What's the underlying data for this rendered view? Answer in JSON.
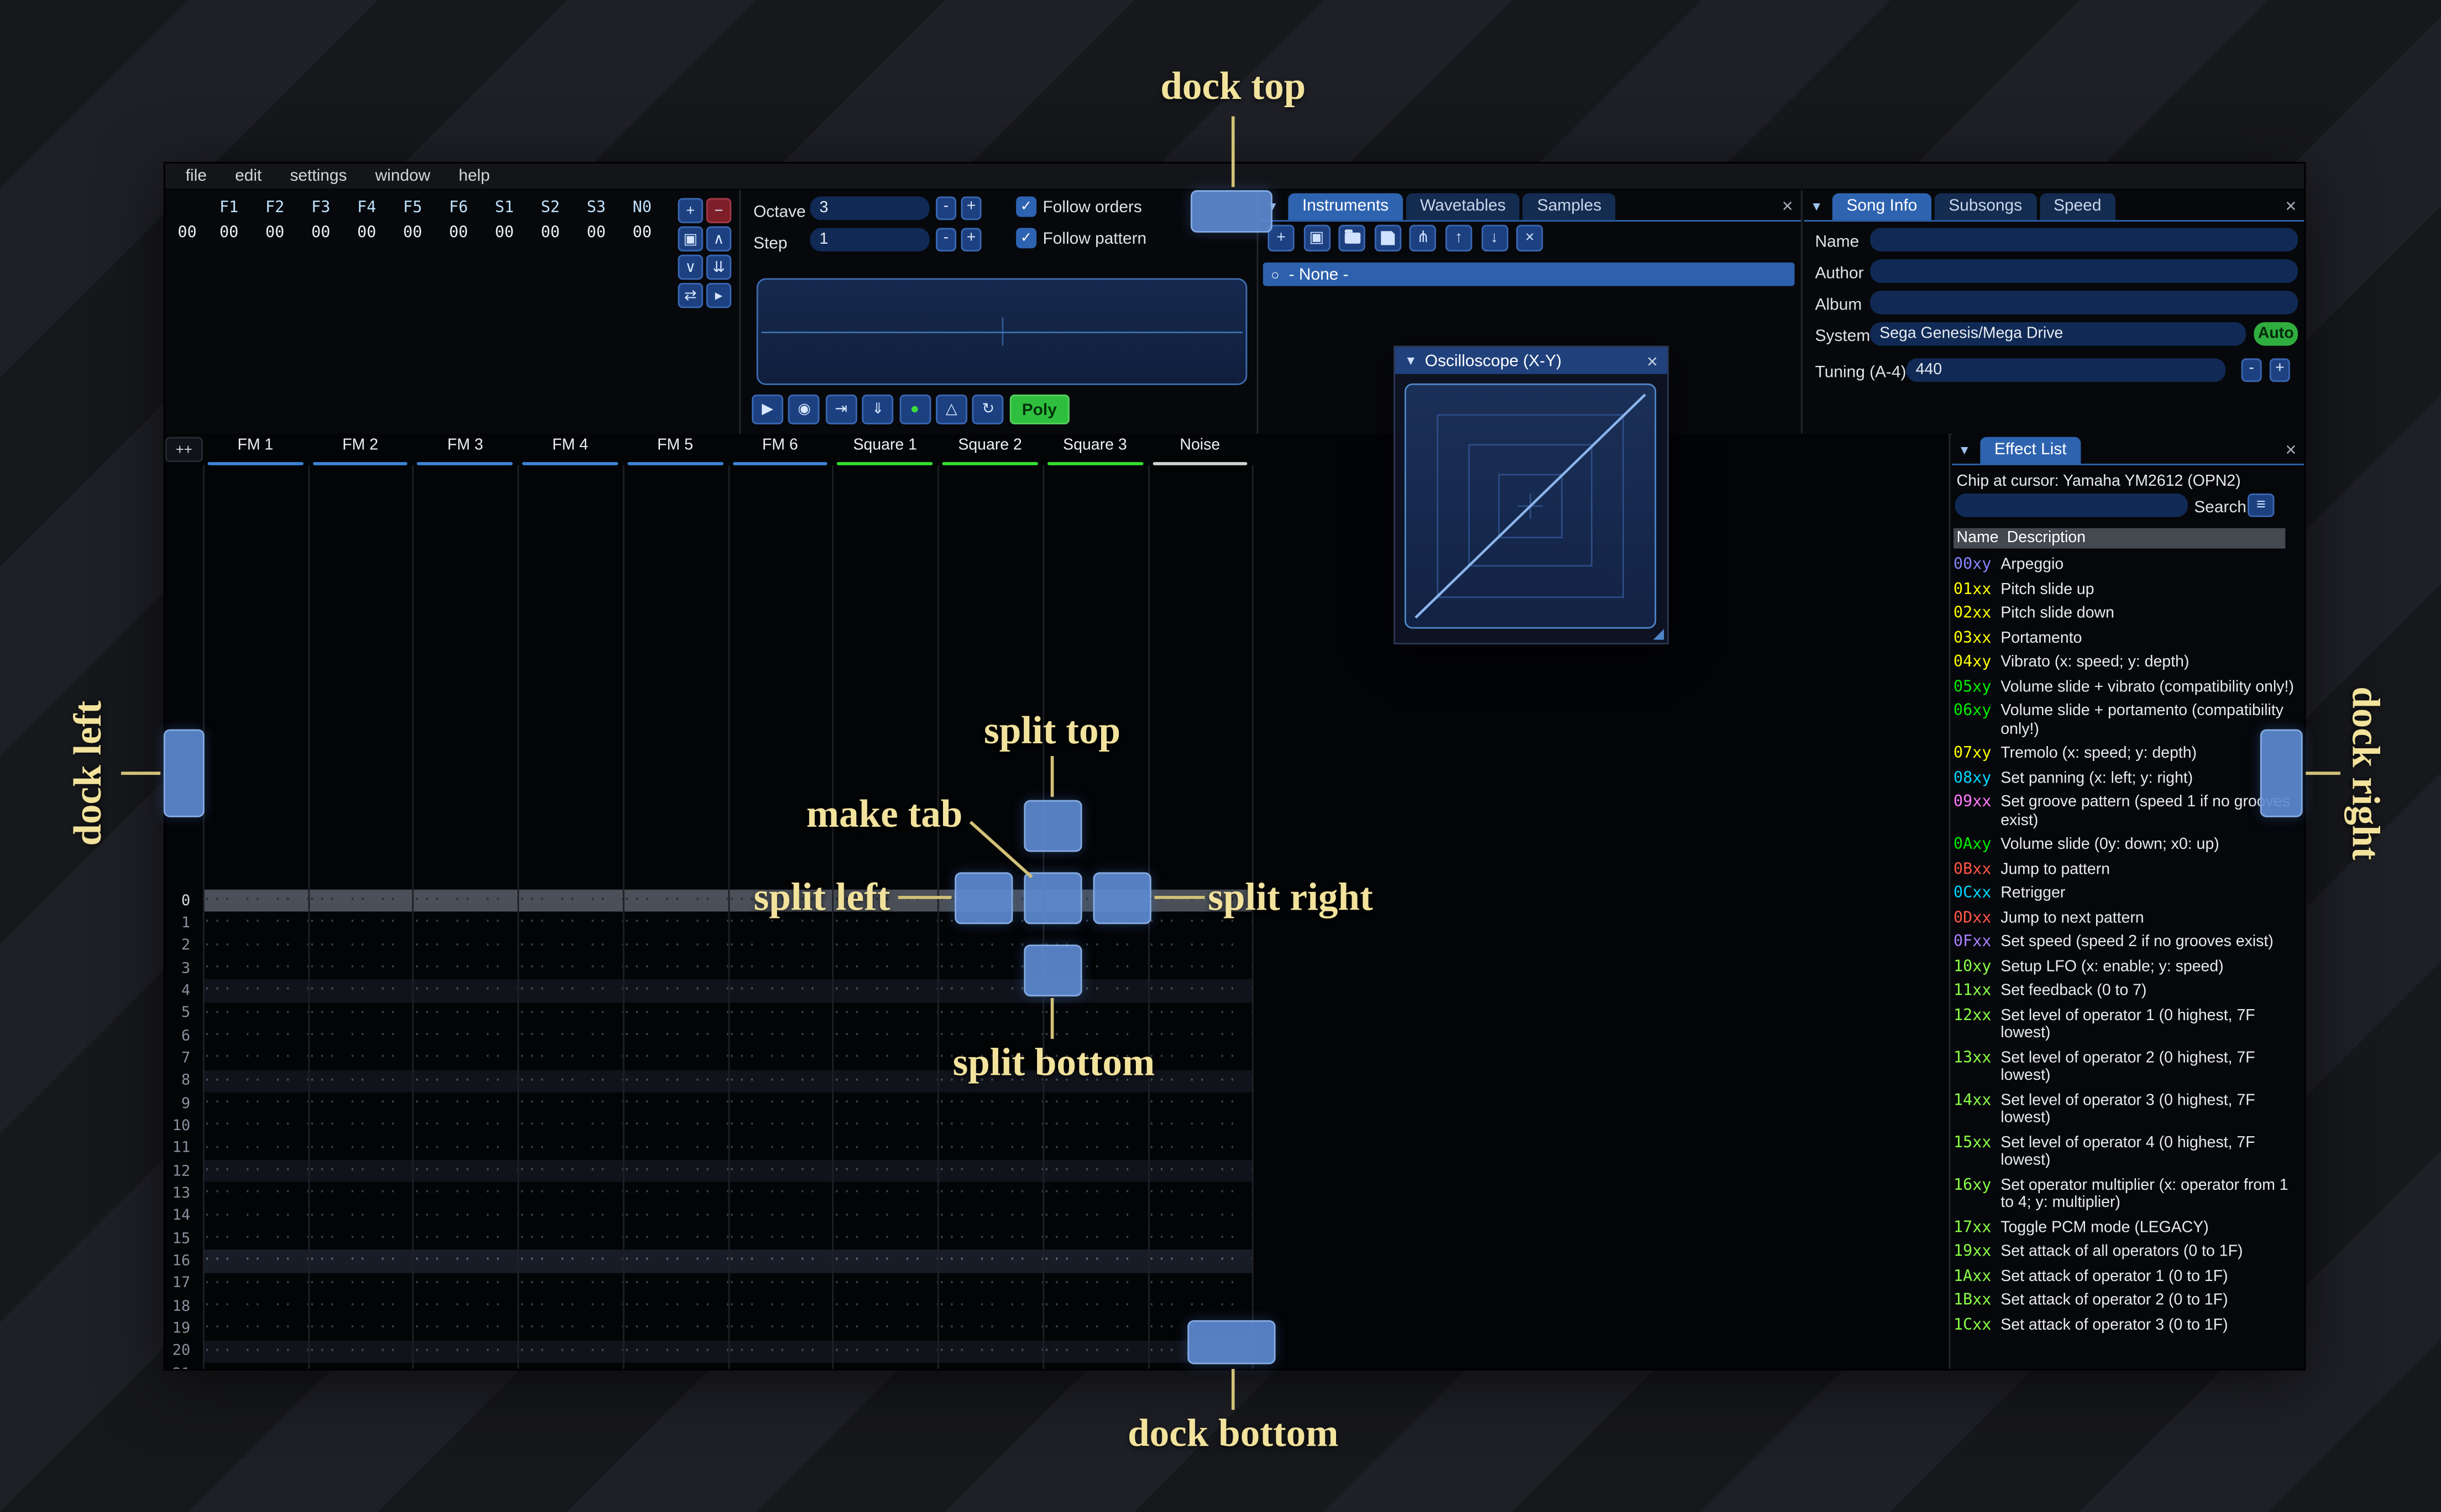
{
  "annotations": {
    "dock_top": "dock top",
    "dock_bottom": "dock bottom",
    "dock_left": "dock left",
    "dock_right": "dock right",
    "split_top": "split top",
    "split_bottom": "split bottom",
    "split_left": "split left",
    "split_right": "split right",
    "make_tab": "make tab"
  },
  "icons": {
    "collapse": "▼",
    "close": "×",
    "radio": "○",
    "check": "✓",
    "menu": "≡",
    "resize": "◢"
  },
  "menu_items": [
    "file",
    "edit",
    "settings",
    "window",
    "help"
  ],
  "orders": {
    "row_index": "00",
    "channel_headers": [
      "F1",
      "F2",
      "F3",
      "F4",
      "F5",
      "F6",
      "S1",
      "S2",
      "S3",
      "N0"
    ],
    "row_values": [
      "00",
      "00",
      "00",
      "00",
      "00",
      "00",
      "00",
      "00",
      "00",
      "00"
    ],
    "buttons": [
      {
        "name": "add-order-button",
        "glyph": "+",
        "variant": "blue"
      },
      {
        "name": "remove-order-button",
        "glyph": "−",
        "variant": "red"
      },
      {
        "name": "duplicate-order-button",
        "glyph": "▣",
        "variant": "blue"
      },
      {
        "name": "move-order-up-button",
        "glyph": "∧",
        "variant": "blue"
      },
      {
        "name": "move-order-down-button",
        "glyph": "∨",
        "variant": "blue"
      },
      {
        "name": "duplicate-order-end-button",
        "glyph": "⇊",
        "variant": "blue"
      },
      {
        "name": "order-change-mode-button",
        "glyph": "⇄",
        "variant": "blue"
      },
      {
        "name": "order-edit-mode-button",
        "glyph": "▸",
        "variant": "blue"
      }
    ]
  },
  "playback": {
    "octave_label": "Octave",
    "octave_value": "3",
    "step_label": "Step",
    "step_value": "1",
    "minus_label": "-",
    "plus_label": "+",
    "follow_orders_label": "Follow orders",
    "follow_pattern_label": "Follow pattern",
    "poly_label": "Poly",
    "transport": [
      {
        "name": "play-button",
        "glyph": "▶"
      },
      {
        "name": "play-pattern-button",
        "glyph": "◉"
      },
      {
        "name": "step-row-button",
        "glyph": "⇥"
      },
      {
        "name": "stop-button",
        "glyph": "⇓"
      },
      {
        "name": "record-button",
        "glyph": "●",
        "color": "#3ddc3d"
      },
      {
        "name": "metronome-button",
        "glyph": "△"
      },
      {
        "name": "repeat-pattern-button",
        "glyph": "↻"
      }
    ]
  },
  "instruments": {
    "tabs": [
      "Instruments",
      "Wavetables",
      "Samples"
    ],
    "active_tab": "Instruments",
    "toolbar": [
      {
        "name": "add-instrument-button",
        "glyph": "+"
      },
      {
        "name": "duplicate-instrument-button",
        "glyph": "▣"
      },
      {
        "name": "open-instrument-button",
        "shape": "folder"
      },
      {
        "name": "save-instrument-button",
        "shape": "floppy"
      },
      {
        "name": "toggle-folders-button",
        "glyph": "⋔"
      },
      {
        "name": "move-instrument-up-button",
        "glyph": "↑"
      },
      {
        "name": "move-instrument-down-button",
        "glyph": "↓"
      },
      {
        "name": "delete-instrument-button",
        "glyph": "×",
        "variant": "red"
      }
    ],
    "selected_item": "- None -"
  },
  "song_info": {
    "tabs": [
      "Song Info",
      "Subsongs",
      "Speed"
    ],
    "active_tab": "Song Info",
    "name_label": "Name",
    "name_value": "",
    "author_label": "Author",
    "author_value": "",
    "album_label": "Album",
    "album_value": "",
    "system_label": "System",
    "system_value": "Sega Genesis/Mega Drive",
    "auto_button": "Auto",
    "tuning_label": "Tuning (A-4)",
    "tuning_value": "440",
    "minus_label": "-",
    "plus_label": "+"
  },
  "pattern": {
    "expand_label": "++",
    "row_count": 22,
    "cursor_row": 0,
    "empty_cell": "··· ·· ·· ··",
    "channels": [
      {
        "name": "FM 1",
        "color": "#3d84d6"
      },
      {
        "name": "FM 2",
        "color": "#3d84d6"
      },
      {
        "name": "FM 3",
        "color": "#3d84d6"
      },
      {
        "name": "FM 4",
        "color": "#3d84d6"
      },
      {
        "name": "FM 5",
        "color": "#3d84d6"
      },
      {
        "name": "FM 6",
        "color": "#3d84d6"
      },
      {
        "name": "Square 1",
        "color": "#35e02f"
      },
      {
        "name": "Square 2",
        "color": "#35e02f"
      },
      {
        "name": "Square 3",
        "color": "#35e02f"
      },
      {
        "name": "Noise",
        "color": "#cfd3d0"
      }
    ]
  },
  "oscilloscope": {
    "title": "Oscilloscope (X-Y)"
  },
  "effect_list": {
    "title": "Effect List",
    "chip_line": "Chip at cursor: Yamaha YM2612 (OPN2)",
    "search_label": "Search",
    "search_value": "",
    "name_col": "Name",
    "desc_col": "Description",
    "effects": [
      {
        "code": "00xy",
        "color": "#8585ff",
        "desc": "Arpeggio"
      },
      {
        "code": "01xx",
        "color": "#ffff00",
        "desc": "Pitch slide up"
      },
      {
        "code": "02xx",
        "color": "#ffff00",
        "desc": "Pitch slide down"
      },
      {
        "code": "03xx",
        "color": "#ffff00",
        "desc": "Portamento"
      },
      {
        "code": "04xy",
        "color": "#ffff00",
        "desc": "Vibrato (x: speed; y: depth)"
      },
      {
        "code": "05xy",
        "color": "#00ee00",
        "desc": "Volume slide + vibrato (compatibility only!)"
      },
      {
        "code": "06xy",
        "color": "#00ee00",
        "desc": "Volume slide + portamento (compatibility only!)"
      },
      {
        "code": "07xy",
        "color": "#ffff00",
        "desc": "Tremolo (x: speed; y: depth)"
      },
      {
        "code": "08xy",
        "color": "#00d5ff",
        "desc": "Set panning (x: left; y: right)"
      },
      {
        "code": "09xx",
        "color": "#ff7bff",
        "desc": "Set groove pattern (speed 1 if no grooves exist)"
      },
      {
        "code": "0Axy",
        "color": "#00ee00",
        "desc": "Volume slide (0y: down; x0: up)"
      },
      {
        "code": "0Bxx",
        "color": "#ff5545",
        "desc": "Jump to pattern"
      },
      {
        "code": "0Cxx",
        "color": "#00d5ff",
        "desc": "Retrigger"
      },
      {
        "code": "0Dxx",
        "color": "#ff5545",
        "desc": "Jump to next pattern"
      },
      {
        "code": "0Fxx",
        "color": "#aa80ff",
        "desc": "Set speed (speed 2 if no grooves exist)"
      },
      {
        "code": "10xy",
        "color": "#8aff45",
        "desc": "Setup LFO (x: enable; y: speed)"
      },
      {
        "code": "11xx",
        "color": "#8aff45",
        "desc": "Set feedback (0 to 7)"
      },
      {
        "code": "12xx",
        "color": "#8aff45",
        "desc": "Set level of operator 1 (0 highest, 7F lowest)"
      },
      {
        "code": "13xx",
        "color": "#8aff45",
        "desc": "Set level of operator 2 (0 highest, 7F lowest)"
      },
      {
        "code": "14xx",
        "color": "#8aff45",
        "desc": "Set level of operator 3 (0 highest, 7F lowest)"
      },
      {
        "code": "15xx",
        "color": "#8aff45",
        "desc": "Set level of operator 4 (0 highest, 7F lowest)"
      },
      {
        "code": "16xy",
        "color": "#8aff45",
        "desc": "Set operator multiplier (x: operator from 1 to 4; y: multiplier)"
      },
      {
        "code": "17xx",
        "color": "#8aff45",
        "desc": "Toggle PCM mode (LEGACY)"
      },
      {
        "code": "19xx",
        "color": "#8aff45",
        "desc": "Set attack of all operators (0 to 1F)"
      },
      {
        "code": "1Axx",
        "color": "#8aff45",
        "desc": "Set attack of operator 1 (0 to 1F)"
      },
      {
        "code": "1Bxx",
        "color": "#8aff45",
        "desc": "Set attack of operator 2 (0 to 1F)"
      },
      {
        "code": "1Cxx",
        "color": "#8aff45",
        "desc": "Set attack of operator 3 (0 to 1F)"
      }
    ]
  }
}
